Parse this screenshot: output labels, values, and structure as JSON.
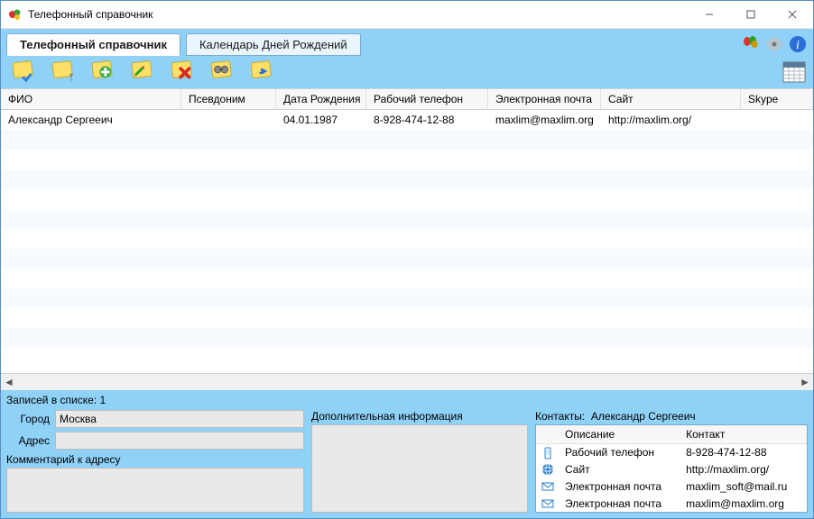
{
  "window": {
    "title": "Телефонный справочник"
  },
  "tabs": {
    "main": "Телефонный справочник",
    "calendar": "Календарь Дней Рождений"
  },
  "grid": {
    "headers": {
      "fio": "ФИО",
      "pseudo": "Псевдоним",
      "dob": "Дата Рождения",
      "wtel": "Рабочий телефон",
      "email": "Электронная почта",
      "site": "Сайт",
      "skype": "Skype"
    },
    "rows": [
      {
        "fio": "Александр Сергееич",
        "pseudo": "",
        "dob": "04.01.1987",
        "wtel": "8-928-474-12-88",
        "email": "maxlim@maxlim.org",
        "site": "http://maxlim.org/",
        "skype": ""
      }
    ]
  },
  "status": {
    "records_label": "Записей в списке: 1"
  },
  "detail": {
    "city_label": "Город",
    "city_value": "Москва",
    "addr_label": "Адрес",
    "addr_value": "",
    "addr_comment_label": "Комментарий к адресу",
    "addr_comment_value": "",
    "extra_label": "Дополнительная информация",
    "extra_value": ""
  },
  "contacts": {
    "heading_prefix": "Контакты:",
    "heading_name": "Александр Сергееич",
    "cols": {
      "desc": "Описание",
      "contact": "Контакт"
    },
    "rows": [
      {
        "icon": "phone-icon",
        "desc": "Рабочий телефон",
        "contact": "8-928-474-12-88"
      },
      {
        "icon": "globe-icon",
        "desc": "Сайт",
        "contact": "http://maxlim.org/"
      },
      {
        "icon": "mail-icon",
        "desc": "Электронная почта",
        "contact": "maxlim_soft@mail.ru"
      },
      {
        "icon": "mail-icon",
        "desc": "Электронная почта",
        "contact": "maxlim@maxlim.org"
      }
    ]
  }
}
